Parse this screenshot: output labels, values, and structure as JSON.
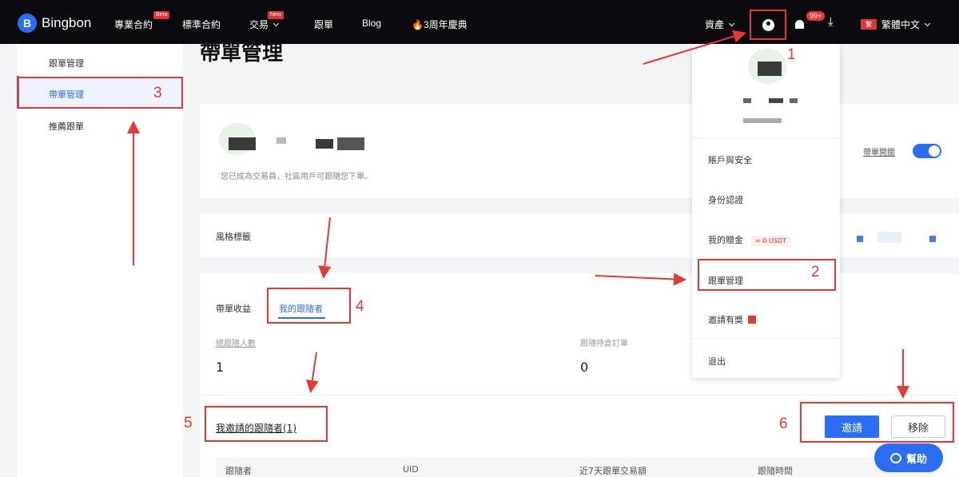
{
  "nav": {
    "logo_mark": "B",
    "logo_text": "Bingbon",
    "items": [
      {
        "label": "專業合約",
        "badge": "Beta"
      },
      {
        "label": "標準合約"
      },
      {
        "label": "交易",
        "badge": "New"
      },
      {
        "label": "跟單"
      },
      {
        "label": "Blog"
      },
      {
        "label": "🔥3周年慶典"
      }
    ],
    "assets_label": "資產",
    "notifications_count": "99+",
    "download_glyph": "⤓",
    "flag_label": "繁",
    "language_label": "繁體中文",
    "icons": [
      "user-icon",
      "bell-icon",
      "download-icon"
    ]
  },
  "sidebar": {
    "items": [
      {
        "label": "跟單管理"
      },
      {
        "label": "帶單管理"
      },
      {
        "label": "推薦跟單"
      }
    ]
  },
  "main": {
    "title": "帶單管理",
    "trader_desc": "您已成為交易員，社區用戶可跟隨您下單。",
    "toggle_label": "帶單開關",
    "style_tags_label": "風格標籤",
    "tabs": [
      {
        "label": "帶單收益"
      },
      {
        "label": "我的跟隨者"
      }
    ],
    "stats": [
      {
        "label": "總跟隨人數",
        "value": "1"
      },
      {
        "label": "跟隨持倉訂單",
        "value": "0"
      }
    ],
    "invited_section": {
      "title": "我邀請的跟隨者(1)",
      "invite_label": "邀請",
      "remove_label": "移除"
    },
    "table_headers": [
      "跟隨者",
      "UID",
      "近7天跟單交易額",
      "跟隨時間"
    ]
  },
  "dropdown": {
    "items": [
      {
        "label": "賬戶與安全"
      },
      {
        "label": "身份認證"
      },
      {
        "label": "我的贈金",
        "badge": "≈ 0 USDT"
      },
      {
        "label": "跟單管理"
      },
      {
        "label": "邀請有獎"
      },
      {
        "label": "退出"
      }
    ]
  },
  "help_label": "幫助",
  "annotations": [
    "1",
    "2",
    "3",
    "4",
    "5",
    "6"
  ],
  "colors": {
    "accent": "#2b6ef5",
    "annotation": "#e53935",
    "topbar": "#0b0b0f"
  }
}
